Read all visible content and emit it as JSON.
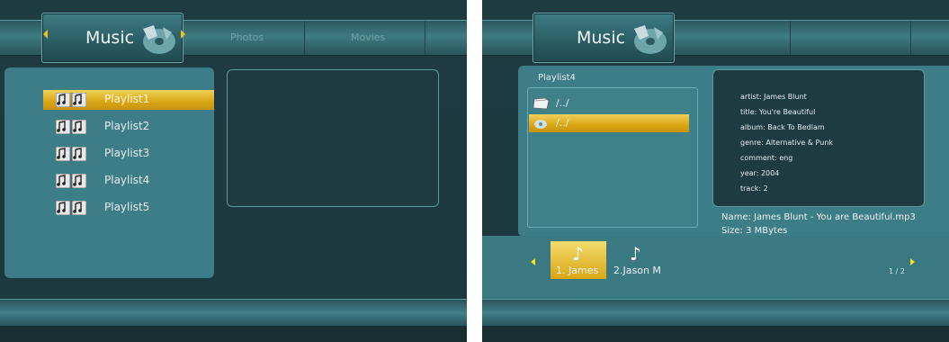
{
  "left_screen": {
    "tabs": {
      "active": "Music",
      "photos": "Photos",
      "movies": "Movies"
    },
    "playlists": [
      {
        "label": "Playlist1",
        "selected": true
      },
      {
        "label": "Playlist2",
        "selected": false
      },
      {
        "label": "Playlist3",
        "selected": false
      },
      {
        "label": "Playlist4",
        "selected": false
      },
      {
        "label": "Playlist5",
        "selected": false
      }
    ]
  },
  "right_screen": {
    "tab_active": "Music",
    "panel_title": "Playlist4",
    "files": [
      {
        "label": "/../",
        "icon": "folder-icon",
        "selected": false
      },
      {
        "label": "/../",
        "icon": "music-file-icon",
        "selected": true
      }
    ],
    "tag_info": {
      "artist": "artist: James Blunt",
      "title": "title: You're Beautiful",
      "album": "album: Back To Bedlam",
      "genre": "genre: Alternative & Punk",
      "comment": "comment: eng",
      "year": "year: 2004",
      "track": "track: 2"
    },
    "file_name": "Name: James Blunt - You are Beautiful.mp3",
    "file_size": "Size: 3 MBytes",
    "thumbnails": [
      {
        "label": "1. James",
        "selected": true
      },
      {
        "label": "2.Jason M",
        "selected": false
      }
    ],
    "page_indicator": "1 / 2"
  },
  "colors": {
    "accent_gold": "#d9a514",
    "teal_panel": "#3d7d87",
    "dark_bg": "#1e3b42"
  }
}
